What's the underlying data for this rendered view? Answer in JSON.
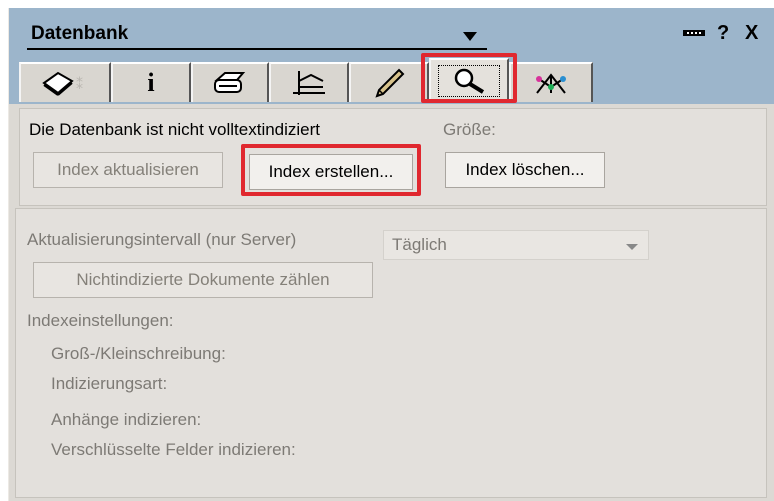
{
  "header": {
    "database_label": "Datenbank",
    "help_label": "?",
    "close_label": "X"
  },
  "tabs": [
    {
      "name": "tab-basics",
      "icon": "book-icon"
    },
    {
      "name": "tab-info",
      "icon": "info-icon",
      "label": "i"
    },
    {
      "name": "tab-print",
      "icon": "printer-icon"
    },
    {
      "name": "tab-design",
      "icon": "design-icon"
    },
    {
      "name": "tab-launch",
      "icon": "pen-icon"
    },
    {
      "name": "tab-fulltext-index",
      "icon": "magnifier-icon",
      "active": true
    },
    {
      "name": "tab-advanced",
      "icon": "advanced-icon"
    }
  ],
  "index_section": {
    "status_text": "Die Datenbank ist nicht volltextindiziert",
    "size_label": "Größe:",
    "update_button": "Index aktualisieren",
    "create_button": "Index erstellen...",
    "delete_button": "Index löschen..."
  },
  "settings_section": {
    "interval_label": "Aktualisierungsintervall (nur Server)",
    "interval_value": "Täglich",
    "count_button": "Nichtindizierte Dokumente zählen",
    "settings_heading": "Indexeinstellungen:",
    "case_label": "Groß-/Kleinschreibung:",
    "index_type_label": "Indizierungsart:",
    "attachments_label": "Anhänge indizieren:",
    "encrypted_label": "Verschlüsselte Felder indizieren:"
  },
  "colors": {
    "titlebar": "#9cb5cb",
    "panel": "#dcd9d4",
    "highlight": "#e0282f"
  }
}
